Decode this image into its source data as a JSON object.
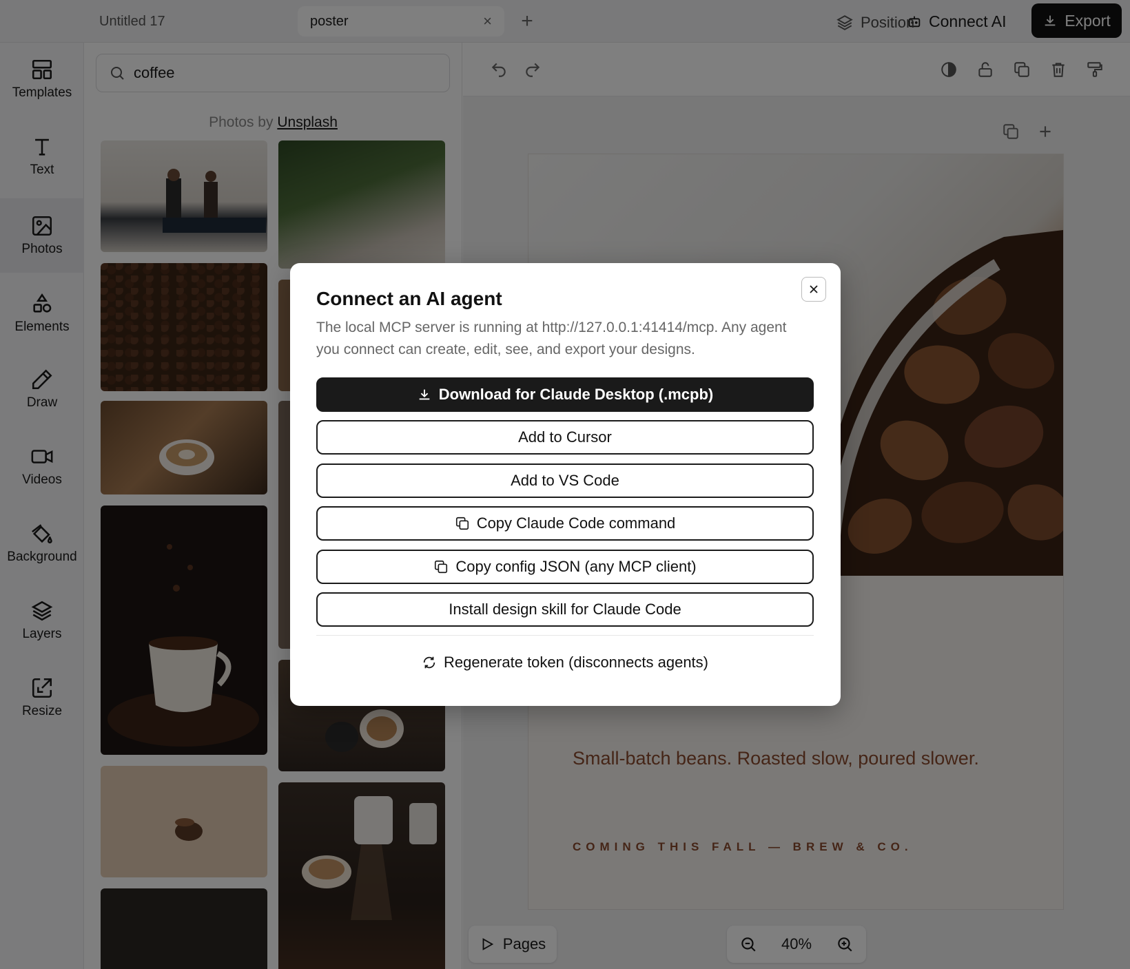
{
  "tabs": [
    {
      "label": "Untitled 17"
    },
    {
      "label": "poster",
      "close": "×"
    }
  ],
  "topbar": {
    "new_tab": "+",
    "connect_ai": "Connect AI",
    "export": "Export"
  },
  "rail": [
    {
      "label": "Templates",
      "icon": "templates-icon"
    },
    {
      "label": "Text",
      "icon": "text-icon"
    },
    {
      "label": "Photos",
      "icon": "photos-icon"
    },
    {
      "label": "Elements",
      "icon": "elements-icon"
    },
    {
      "label": "Draw",
      "icon": "draw-icon"
    },
    {
      "label": "Videos",
      "icon": "videos-icon"
    },
    {
      "label": "Background",
      "icon": "background-icon"
    },
    {
      "label": "Layers",
      "icon": "layers-icon"
    },
    {
      "label": "Resize",
      "icon": "resize-icon"
    }
  ],
  "search": {
    "value": "coffee"
  },
  "credit": {
    "prefix": "Photos by",
    "link": "Unsplash"
  },
  "toolbar": {
    "position": "Position"
  },
  "poster": {
    "tagline": "Small-batch beans. Roasted slow, poured slower.",
    "footer": "COMING THIS FALL — BREW & CO."
  },
  "bottom": {
    "pages": "Pages",
    "zoom": "40%"
  },
  "modal": {
    "title": "Connect an AI agent",
    "description": "The local MCP server is running at http://127.0.0.1:41414/mcp. Any agent you connect can create, edit, see, and export your designs.",
    "buttons": [
      {
        "label": "Download for Claude Desktop (.mcpb)"
      },
      {
        "label": "Add to Cursor"
      },
      {
        "label": "Add to VS Code"
      },
      {
        "label": "Copy Claude Code command"
      },
      {
        "label": "Copy config JSON (any MCP client)"
      },
      {
        "label": "Install design skill for Claude Code"
      }
    ],
    "regenerate": "Regenerate token (disconnects agents)"
  },
  "colors": {
    "accent": "#1a1a1a",
    "poster_text": "#8a4a2e",
    "overlay": "#00000080"
  }
}
